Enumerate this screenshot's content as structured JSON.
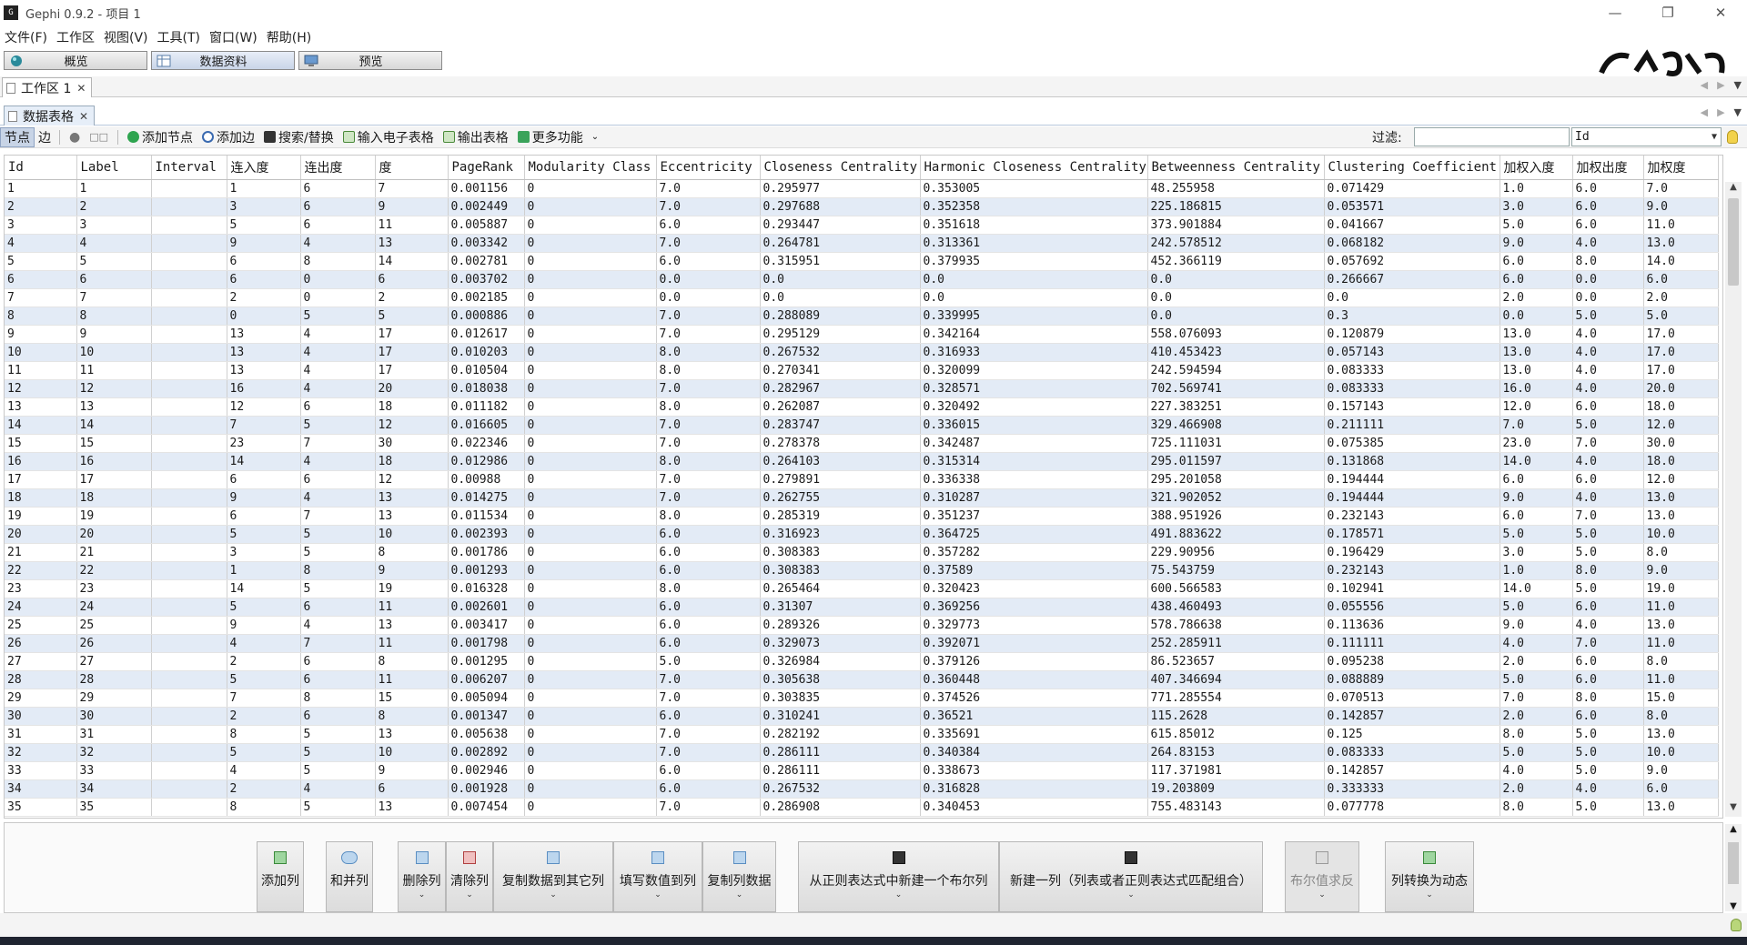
{
  "window": {
    "title": "Gephi 0.9.2 - 项目 1",
    "app_icon_text": "G"
  },
  "menu": [
    "文件(F)",
    "工作区",
    "视图(V)",
    "工具(T)",
    "窗口(W)",
    "帮助(H)"
  ],
  "perspectives": [
    "概览",
    "数据资料",
    "预览"
  ],
  "workspace_tab": "工作区 1",
  "datatable_tab": "数据表格",
  "toolbar": {
    "nodes": "节点",
    "edges": "边",
    "add_node": "添加节点",
    "add_edge": "添加边",
    "search_replace": "搜索/替换",
    "import_spreadsheet": "输入电子表格",
    "export_table": "输出表格",
    "more": "更多功能",
    "filter_label": "过滤:",
    "filter_column": "Id"
  },
  "columns": [
    "Id",
    "Label",
    "Interval",
    "连入度",
    "连出度",
    "度",
    "PageRank",
    "Modularity Class",
    "Eccentricity",
    "Closeness Centrality",
    "Harmonic Closeness Centrality",
    "Betweenness Centrality",
    "Clustering Coefficient",
    "加权入度",
    "加权出度",
    "加权度"
  ],
  "rows": [
    [
      "1",
      "1",
      "",
      "1",
      "6",
      "7",
      "0.001156",
      "0",
      "7.0",
      "0.295977",
      "0.353005",
      "48.255958",
      "0.071429",
      "1.0",
      "6.0",
      "7.0"
    ],
    [
      "2",
      "2",
      "",
      "3",
      "6",
      "9",
      "0.002449",
      "0",
      "7.0",
      "0.297688",
      "0.352358",
      "225.186815",
      "0.053571",
      "3.0",
      "6.0",
      "9.0"
    ],
    [
      "3",
      "3",
      "",
      "5",
      "6",
      "11",
      "0.005887",
      "0",
      "6.0",
      "0.293447",
      "0.351618",
      "373.901884",
      "0.041667",
      "5.0",
      "6.0",
      "11.0"
    ],
    [
      "4",
      "4",
      "",
      "9",
      "4",
      "13",
      "0.003342",
      "0",
      "7.0",
      "0.264781",
      "0.313361",
      "242.578512",
      "0.068182",
      "9.0",
      "4.0",
      "13.0"
    ],
    [
      "5",
      "5",
      "",
      "6",
      "8",
      "14",
      "0.002781",
      "0",
      "6.0",
      "0.315951",
      "0.379935",
      "452.366119",
      "0.057692",
      "6.0",
      "8.0",
      "14.0"
    ],
    [
      "6",
      "6",
      "",
      "6",
      "0",
      "6",
      "0.003702",
      "0",
      "0.0",
      "0.0",
      "0.0",
      "0.0",
      "0.266667",
      "6.0",
      "0.0",
      "6.0"
    ],
    [
      "7",
      "7",
      "",
      "2",
      "0",
      "2",
      "0.002185",
      "0",
      "0.0",
      "0.0",
      "0.0",
      "0.0",
      "0.0",
      "2.0",
      "0.0",
      "2.0"
    ],
    [
      "8",
      "8",
      "",
      "0",
      "5",
      "5",
      "0.000886",
      "0",
      "7.0",
      "0.288089",
      "0.339995",
      "0.0",
      "0.3",
      "0.0",
      "5.0",
      "5.0"
    ],
    [
      "9",
      "9",
      "",
      "13",
      "4",
      "17",
      "0.012617",
      "0",
      "7.0",
      "0.295129",
      "0.342164",
      "558.076093",
      "0.120879",
      "13.0",
      "4.0",
      "17.0"
    ],
    [
      "10",
      "10",
      "",
      "13",
      "4",
      "17",
      "0.010203",
      "0",
      "8.0",
      "0.267532",
      "0.316933",
      "410.453423",
      "0.057143",
      "13.0",
      "4.0",
      "17.0"
    ],
    [
      "11",
      "11",
      "",
      "13",
      "4",
      "17",
      "0.010504",
      "0",
      "8.0",
      "0.270341",
      "0.320099",
      "242.594594",
      "0.083333",
      "13.0",
      "4.0",
      "17.0"
    ],
    [
      "12",
      "12",
      "",
      "16",
      "4",
      "20",
      "0.018038",
      "0",
      "7.0",
      "0.282967",
      "0.328571",
      "702.569741",
      "0.083333",
      "16.0",
      "4.0",
      "20.0"
    ],
    [
      "13",
      "13",
      "",
      "12",
      "6",
      "18",
      "0.011182",
      "0",
      "8.0",
      "0.262087",
      "0.320492",
      "227.383251",
      "0.157143",
      "12.0",
      "6.0",
      "18.0"
    ],
    [
      "14",
      "14",
      "",
      "7",
      "5",
      "12",
      "0.016605",
      "0",
      "7.0",
      "0.283747",
      "0.336015",
      "329.466908",
      "0.211111",
      "7.0",
      "5.0",
      "12.0"
    ],
    [
      "15",
      "15",
      "",
      "23",
      "7",
      "30",
      "0.022346",
      "0",
      "7.0",
      "0.278378",
      "0.342487",
      "725.111031",
      "0.075385",
      "23.0",
      "7.0",
      "30.0"
    ],
    [
      "16",
      "16",
      "",
      "14",
      "4",
      "18",
      "0.012986",
      "0",
      "8.0",
      "0.264103",
      "0.315314",
      "295.011597",
      "0.131868",
      "14.0",
      "4.0",
      "18.0"
    ],
    [
      "17",
      "17",
      "",
      "6",
      "6",
      "12",
      "0.00988",
      "0",
      "7.0",
      "0.279891",
      "0.336338",
      "295.201058",
      "0.194444",
      "6.0",
      "6.0",
      "12.0"
    ],
    [
      "18",
      "18",
      "",
      "9",
      "4",
      "13",
      "0.014275",
      "0",
      "7.0",
      "0.262755",
      "0.310287",
      "321.902052",
      "0.194444",
      "9.0",
      "4.0",
      "13.0"
    ],
    [
      "19",
      "19",
      "",
      "6",
      "7",
      "13",
      "0.011534",
      "0",
      "8.0",
      "0.285319",
      "0.351237",
      "388.951926",
      "0.232143",
      "6.0",
      "7.0",
      "13.0"
    ],
    [
      "20",
      "20",
      "",
      "5",
      "5",
      "10",
      "0.002393",
      "0",
      "6.0",
      "0.316923",
      "0.364725",
      "491.883622",
      "0.178571",
      "5.0",
      "5.0",
      "10.0"
    ],
    [
      "21",
      "21",
      "",
      "3",
      "5",
      "8",
      "0.001786",
      "0",
      "6.0",
      "0.308383",
      "0.357282",
      "229.90956",
      "0.196429",
      "3.0",
      "5.0",
      "8.0"
    ],
    [
      "22",
      "22",
      "",
      "1",
      "8",
      "9",
      "0.001293",
      "0",
      "6.0",
      "0.308383",
      "0.37589",
      "75.543759",
      "0.232143",
      "1.0",
      "8.0",
      "9.0"
    ],
    [
      "23",
      "23",
      "",
      "14",
      "5",
      "19",
      "0.016328",
      "0",
      "8.0",
      "0.265464",
      "0.320423",
      "600.566583",
      "0.102941",
      "14.0",
      "5.0",
      "19.0"
    ],
    [
      "24",
      "24",
      "",
      "5",
      "6",
      "11",
      "0.002601",
      "0",
      "6.0",
      "0.31307",
      "0.369256",
      "438.460493",
      "0.055556",
      "5.0",
      "6.0",
      "11.0"
    ],
    [
      "25",
      "25",
      "",
      "9",
      "4",
      "13",
      "0.003417",
      "0",
      "6.0",
      "0.289326",
      "0.329773",
      "578.786638",
      "0.113636",
      "9.0",
      "4.0",
      "13.0"
    ],
    [
      "26",
      "26",
      "",
      "4",
      "7",
      "11",
      "0.001798",
      "0",
      "6.0",
      "0.329073",
      "0.392071",
      "252.285911",
      "0.111111",
      "4.0",
      "7.0",
      "11.0"
    ],
    [
      "27",
      "27",
      "",
      "2",
      "6",
      "8",
      "0.001295",
      "0",
      "5.0",
      "0.326984",
      "0.379126",
      "86.523657",
      "0.095238",
      "2.0",
      "6.0",
      "8.0"
    ],
    [
      "28",
      "28",
      "",
      "5",
      "6",
      "11",
      "0.006207",
      "0",
      "7.0",
      "0.305638",
      "0.360448",
      "407.346694",
      "0.088889",
      "5.0",
      "6.0",
      "11.0"
    ],
    [
      "29",
      "29",
      "",
      "7",
      "8",
      "15",
      "0.005094",
      "0",
      "7.0",
      "0.303835",
      "0.374526",
      "771.285554",
      "0.070513",
      "7.0",
      "8.0",
      "15.0"
    ],
    [
      "30",
      "30",
      "",
      "2",
      "6",
      "8",
      "0.001347",
      "0",
      "6.0",
      "0.310241",
      "0.36521",
      "115.2628",
      "0.142857",
      "2.0",
      "6.0",
      "8.0"
    ],
    [
      "31",
      "31",
      "",
      "8",
      "5",
      "13",
      "0.005638",
      "0",
      "7.0",
      "0.282192",
      "0.335691",
      "615.85012",
      "0.125",
      "8.0",
      "5.0",
      "13.0"
    ],
    [
      "32",
      "32",
      "",
      "5",
      "5",
      "10",
      "0.002892",
      "0",
      "7.0",
      "0.286111",
      "0.340384",
      "264.83153",
      "0.083333",
      "5.0",
      "5.0",
      "10.0"
    ],
    [
      "33",
      "33",
      "",
      "4",
      "5",
      "9",
      "0.002946",
      "0",
      "6.0",
      "0.286111",
      "0.338673",
      "117.371981",
      "0.142857",
      "4.0",
      "5.0",
      "9.0"
    ],
    [
      "34",
      "34",
      "",
      "2",
      "4",
      "6",
      "0.001928",
      "0",
      "6.0",
      "0.267532",
      "0.316828",
      "19.203809",
      "0.333333",
      "2.0",
      "4.0",
      "6.0"
    ],
    [
      "35",
      "35",
      "",
      "8",
      "5",
      "13",
      "0.007454",
      "0",
      "7.0",
      "0.286908",
      "0.340453",
      "755.483143",
      "0.077778",
      "8.0",
      "5.0",
      "13.0"
    ]
  ],
  "actions": {
    "add_column": "添加列",
    "merge_columns": "和并列",
    "delete_column": "删除列",
    "clear_column": "清除列",
    "copy_data_to_other_column": "复制数据到其它列",
    "fill_value_to_column": "填写数值到列",
    "duplicate_column": "复制列数据",
    "new_boolean_from_regex": "从正则表达式中新建一个布尔列",
    "new_column_regex_match": "新建一列（列表或者正则表达式匹配组合）",
    "negate_boolean": "布尔值求反",
    "column_to_dynamic": "列转换为动态"
  },
  "colors": {
    "row_alt": "#e3ebf6",
    "accent": "#c8d4e6"
  }
}
